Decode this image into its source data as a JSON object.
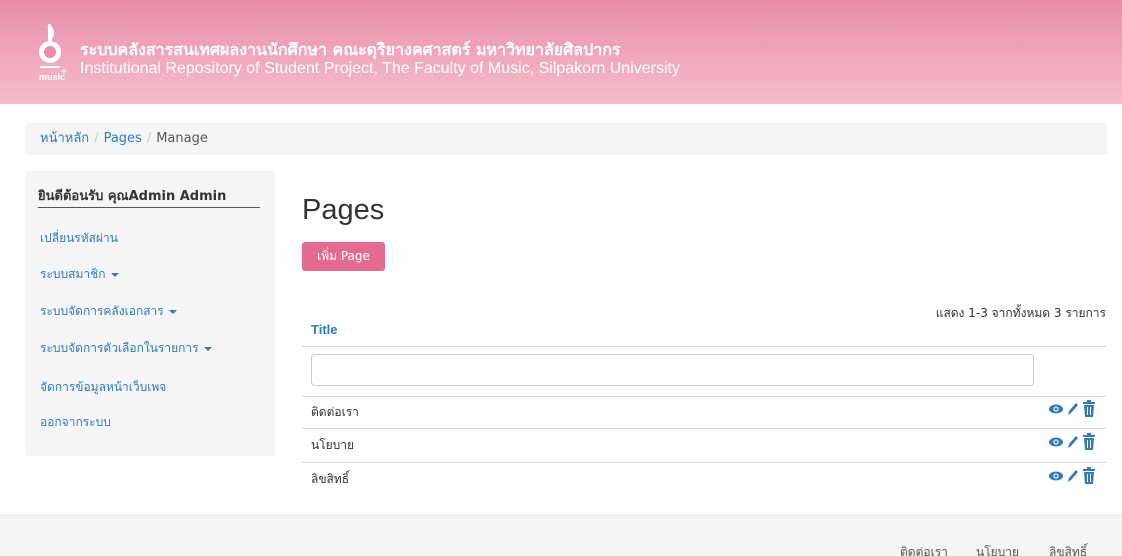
{
  "header": {
    "logo_text": "music",
    "title_th": "ระบบคลังสารสนเทศผลงานนักศึกษา คณะดุริยางคศาสตร์ มหาวิทยาลัยศิลปากร",
    "title_en": "Institutional Repository of Student Project, The Faculty of Music, Silpakorn University",
    "color": "#e88ca9"
  },
  "breadcrumb": {
    "home": "หน้าหลัก",
    "pages": "Pages",
    "current": "Manage",
    "separator": "/"
  },
  "sidebar": {
    "welcome": "ยินดีต้อนรับ คุณAdmin Admin",
    "items": [
      {
        "label": "เปลี่ยนรหัสผ่าน",
        "dropdown": false
      },
      {
        "label": "ระบบสมาชิก",
        "dropdown": true
      },
      {
        "label": "ระบบจัดการคลังเอกสาร",
        "dropdown": true
      },
      {
        "label": "ระบบจัดการตัวเลือกในรายการ",
        "dropdown": true
      },
      {
        "label": "จัดการข้อมูลหน้าเว็บเพจ",
        "dropdown": false
      },
      {
        "label": "ออกจากระบบ",
        "dropdown": false
      }
    ]
  },
  "main": {
    "title": "Pages",
    "add_button": "เพิ่ม Page",
    "button_color": "#e46b8d",
    "summary": "แสดง 1-3 จากทั้งหมด 3 รายการ",
    "column_title": "Title",
    "filter_value": "",
    "rows": [
      {
        "title": "ติดต่อเรา"
      },
      {
        "title": "นโยบาย"
      },
      {
        "title": "ลิขสิทธิ์"
      }
    ],
    "row_actions": [
      "eye-icon",
      "pencil-icon",
      "trash-icon"
    ]
  },
  "footer": {
    "links": [
      "ติดต่อเรา",
      "นโยบาย",
      "ลิขสิทธิ์"
    ]
  }
}
